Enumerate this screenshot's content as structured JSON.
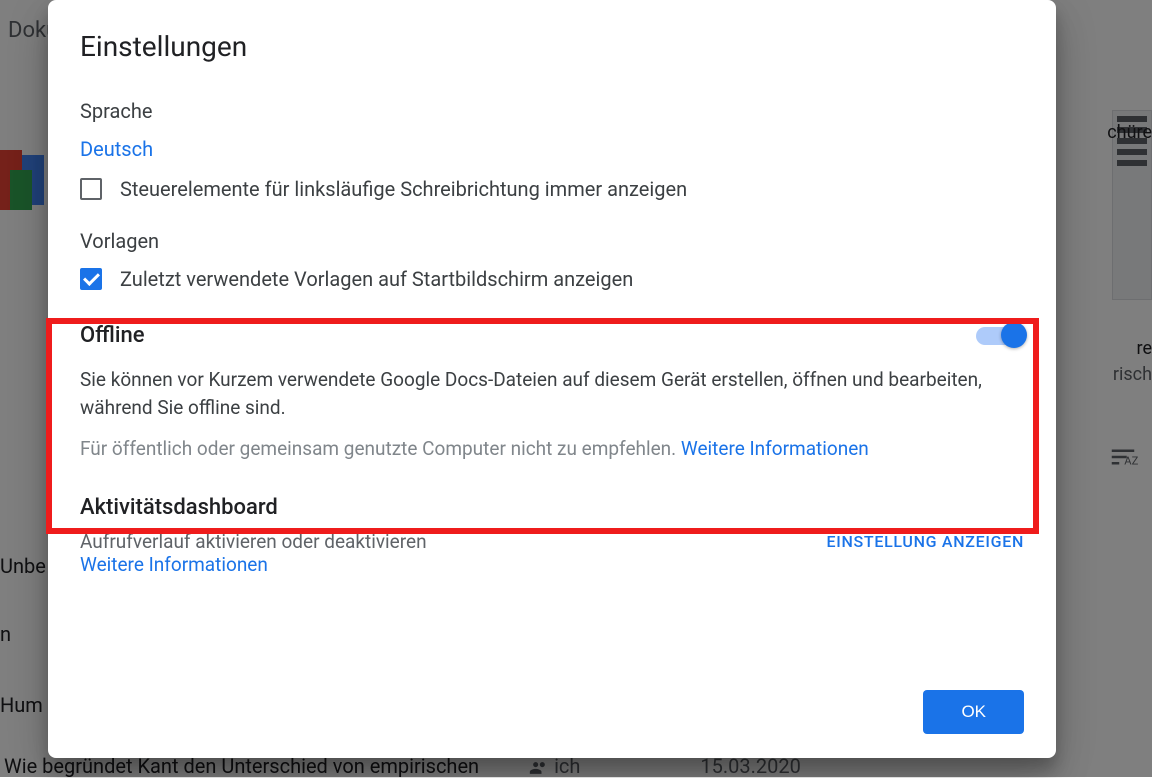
{
  "background": {
    "appLabel": "Doku",
    "label1": "Unbe",
    "label2": "n",
    "label3": "Hum",
    "bottomText": "Wie begründet Kant den Unterschied von empirischen",
    "bottomOwner": "ich",
    "bottomDate": "15.03.2020",
    "rightTemplate1": "chüre",
    "rightTemplate2a": "re",
    "rightTemplate2b": "risch"
  },
  "dialog": {
    "title": "Einstellungen",
    "language": {
      "title": "Sprache",
      "value": "Deutsch",
      "rtlCheckboxLabel": "Steuerelemente für linksläufige Schreibrichtung immer anzeigen"
    },
    "templates": {
      "title": "Vorlagen",
      "recentCheckboxLabel": "Zuletzt verwendete Vorlagen auf Startbildschirm anzeigen"
    },
    "offline": {
      "title": "Offline",
      "description": "Sie können vor Kurzem verwendete Google Docs-Dateien auf diesem Gerät erstellen, öffnen und bearbeiten, während Sie offline sind.",
      "warning": "Für öffentlich oder gemeinsam genutzte Computer nicht zu empfehlen. ",
      "moreInfo": "Weitere Informationen"
    },
    "activity": {
      "title": "Aktivitätsdashboard",
      "subtitle": "Aufrufverlauf aktivieren oder deaktivieren",
      "moreInfo": "Weitere Informationen",
      "showSettings": "EINSTELLUNG ANZEIGEN"
    },
    "okLabel": "OK"
  }
}
